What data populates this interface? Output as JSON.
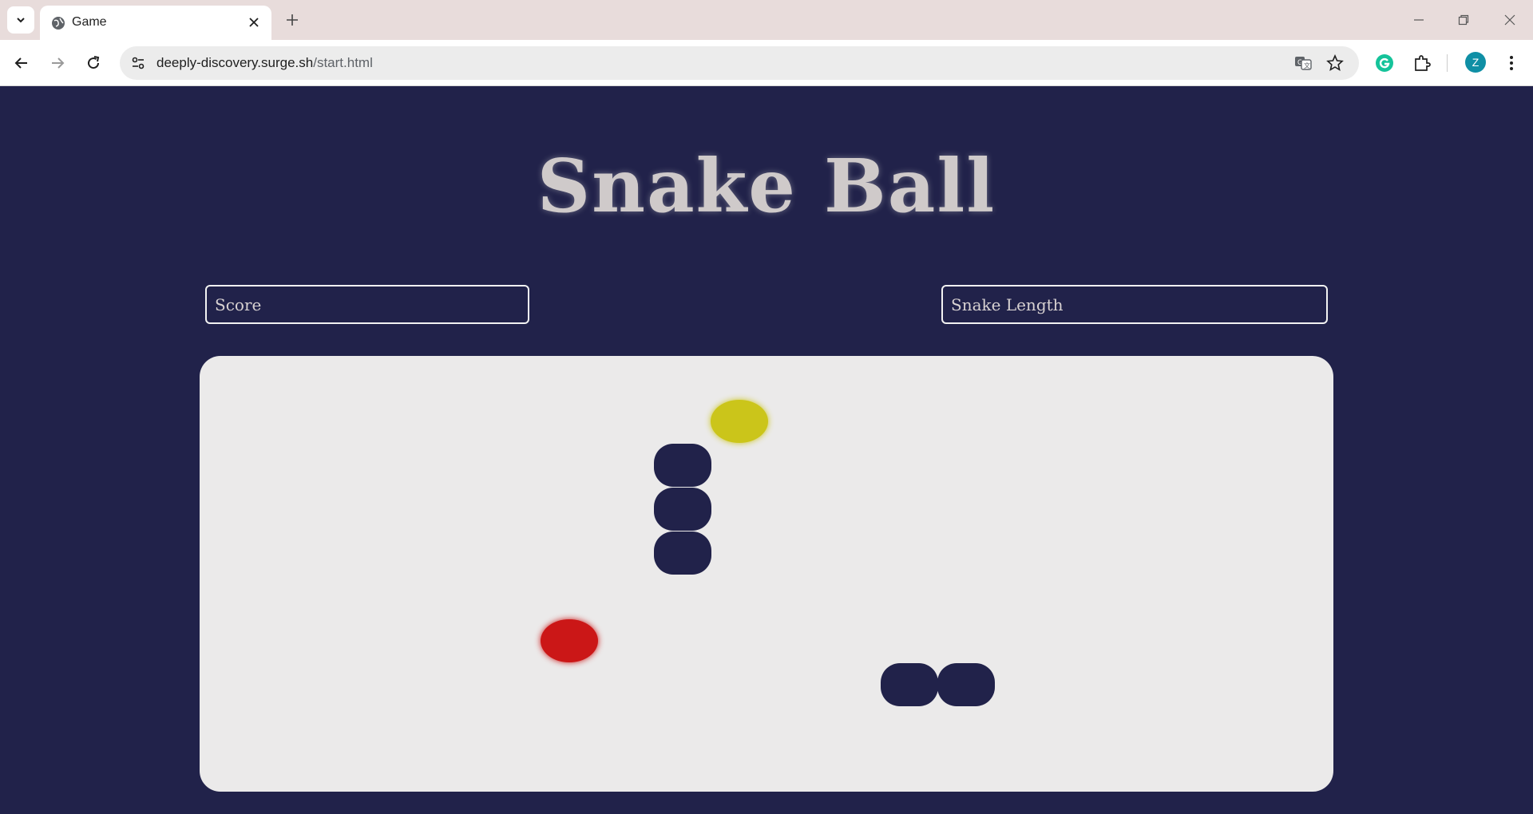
{
  "browser": {
    "tab_title": "Game",
    "url_domain": "deeply-discovery.surge.sh",
    "url_path": "/start.html",
    "profile_initial": "Z"
  },
  "page": {
    "title": "Snake Ball",
    "score_placeholder": "Score",
    "length_placeholder": "Snake Length"
  },
  "colors": {
    "background": "#21224a",
    "board": "#ebeaea",
    "snake": "#21224a",
    "food_ball": "#cbc51a",
    "danger_ball": "#cb1717"
  },
  "board": {
    "cols": 20,
    "rows": 10,
    "food": {
      "col": 9,
      "row": 1
    },
    "danger": {
      "col": 6,
      "row": 6
    },
    "snake_a": [
      {
        "col": 8,
        "row": 2
      },
      {
        "col": 8,
        "row": 3
      },
      {
        "col": 8,
        "row": 4
      }
    ],
    "snake_b": [
      {
        "col": 12,
        "row": 7
      },
      {
        "col": 13,
        "row": 7
      }
    ]
  }
}
